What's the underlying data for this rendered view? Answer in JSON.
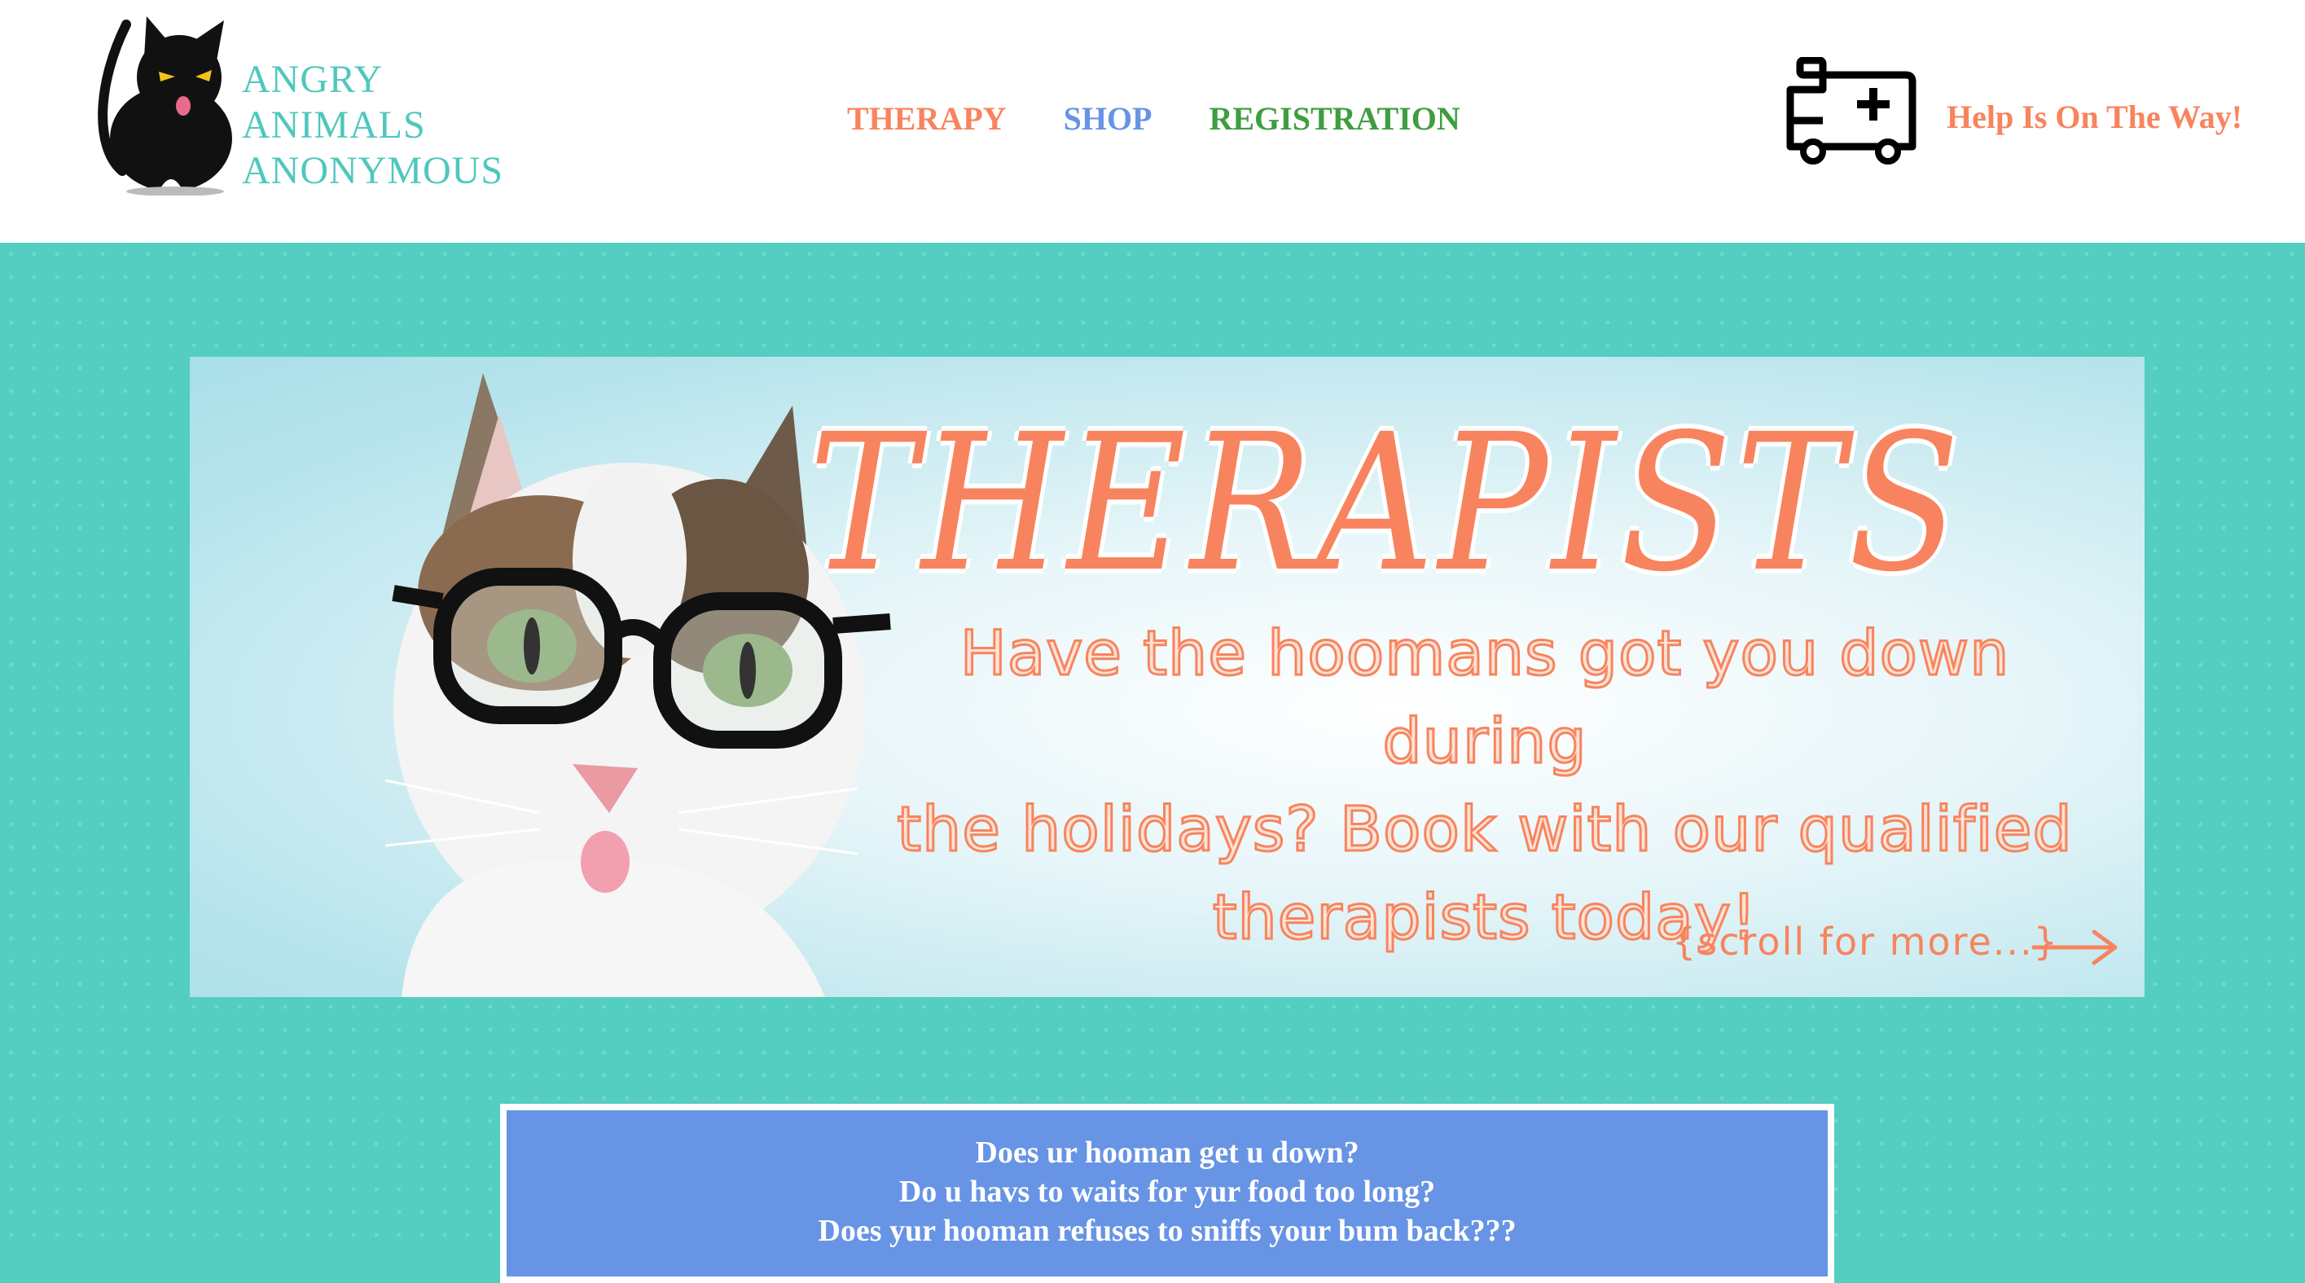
{
  "header": {
    "logo_lines": [
      "ANGRY",
      "ANIMALS",
      "ANONYMOUS"
    ],
    "nav": [
      {
        "label": "THERAPY",
        "color": "#f7845e"
      },
      {
        "label": "SHOP",
        "color": "#6794e4"
      },
      {
        "label": "REGISTRATION",
        "color": "#3f9e40"
      }
    ],
    "help_text": "Help Is On The Way!",
    "help_icon": "ambulance-icon"
  },
  "banner": {
    "title": "THERAPISTS",
    "subtitle_lines": [
      "Have the hoomans got you down during",
      "the holidays? Book with our qualified",
      "therapists today!"
    ],
    "scroll_text": "{scroll for more...}"
  },
  "question_box": {
    "lines": [
      "Does ur hooman get u down?",
      "Do u havs to waits for yur food too long?",
      "Does yur hooman refuses to sniffs your bum back???"
    ]
  },
  "colors": {
    "teal": "#53cec0",
    "logo_teal": "#4fc8bd",
    "coral": "#f7845e",
    "blue": "#6794e4",
    "green": "#3f9e40",
    "white": "#ffffff"
  }
}
